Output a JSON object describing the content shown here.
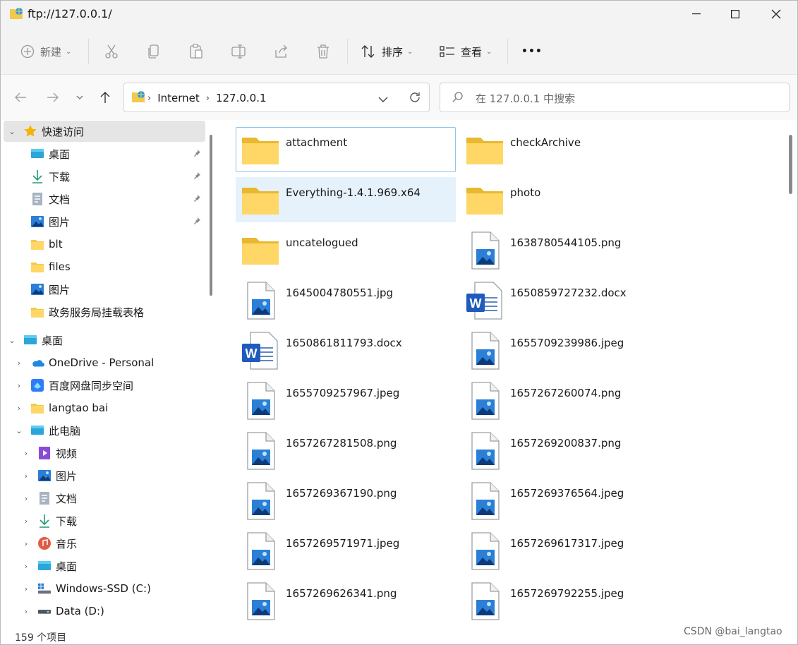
{
  "window": {
    "title": "ftp://127.0.0.1/"
  },
  "toolbar": {
    "new_label": "新建",
    "sort_label": "排序",
    "view_label": "查看",
    "more_label": "•••"
  },
  "address": {
    "crumbs": [
      "Internet",
      "127.0.0.1"
    ],
    "search_placeholder": "在 127.0.0.1 中搜索"
  },
  "sidebar": {
    "quick_access": "快速访问",
    "quick_items": [
      {
        "label": "桌面",
        "icon": "desktop-icon",
        "pinned": true
      },
      {
        "label": "下载",
        "icon": "download-icon",
        "pinned": true
      },
      {
        "label": "文档",
        "icon": "document-icon",
        "pinned": true
      },
      {
        "label": "图片",
        "icon": "pictures-icon",
        "pinned": true
      },
      {
        "label": "blt",
        "icon": "folder-icon",
        "pinned": false
      },
      {
        "label": "files",
        "icon": "folder-icon",
        "pinned": false
      },
      {
        "label": "图片",
        "icon": "pictures-icon",
        "pinned": false
      },
      {
        "label": "政务服务局挂载表格",
        "icon": "folder-icon",
        "pinned": false
      }
    ],
    "desktop": "桌面",
    "desktop_children": [
      {
        "label": "OneDrive - Personal",
        "icon": "onedrive-icon"
      },
      {
        "label": "百度网盘同步空间",
        "icon": "baidu-netdisk-icon"
      },
      {
        "label": "langtao bai",
        "icon": "folder-icon"
      }
    ],
    "this_pc": "此电脑",
    "pc_children": [
      {
        "label": "视频",
        "icon": "videos-icon"
      },
      {
        "label": "图片",
        "icon": "pictures-icon"
      },
      {
        "label": "文档",
        "icon": "document-icon"
      },
      {
        "label": "下载",
        "icon": "download-icon"
      },
      {
        "label": "音乐",
        "icon": "music-icon"
      },
      {
        "label": "桌面",
        "icon": "desktop-icon"
      },
      {
        "label": "Windows-SSD (C:)",
        "icon": "windows-drive-icon"
      },
      {
        "label": "Data (D:)",
        "icon": "drive-icon"
      }
    ]
  },
  "files": [
    {
      "name": "attachment",
      "type": "folder"
    },
    {
      "name": "checkArchive",
      "type": "folder"
    },
    {
      "name": "Everything-1.4.1.969.x64",
      "type": "folder"
    },
    {
      "name": "photo",
      "type": "folder"
    },
    {
      "name": "uncatelogued",
      "type": "folder"
    },
    {
      "name": "1638780544105.png",
      "type": "image"
    },
    {
      "name": "1645004780551.jpg",
      "type": "image"
    },
    {
      "name": "1650859727232.docx",
      "type": "word"
    },
    {
      "name": "1650861811793.docx",
      "type": "word"
    },
    {
      "name": "1655709239986.jpeg",
      "type": "image"
    },
    {
      "name": "1655709257967.jpeg",
      "type": "image"
    },
    {
      "name": "1657267260074.png",
      "type": "image"
    },
    {
      "name": "1657267281508.png",
      "type": "image"
    },
    {
      "name": "1657269200837.png",
      "type": "image"
    },
    {
      "name": "1657269367190.png",
      "type": "image"
    },
    {
      "name": "1657269376564.jpeg",
      "type": "image"
    },
    {
      "name": "1657269571971.jpeg",
      "type": "image"
    },
    {
      "name": "1657269617317.jpeg",
      "type": "image"
    },
    {
      "name": "1657269626341.png",
      "type": "image"
    },
    {
      "name": "1657269792255.jpeg",
      "type": "image"
    }
  ],
  "status": {
    "item_count": "159 个项目"
  },
  "watermark": "CSDN @bai_langtao"
}
